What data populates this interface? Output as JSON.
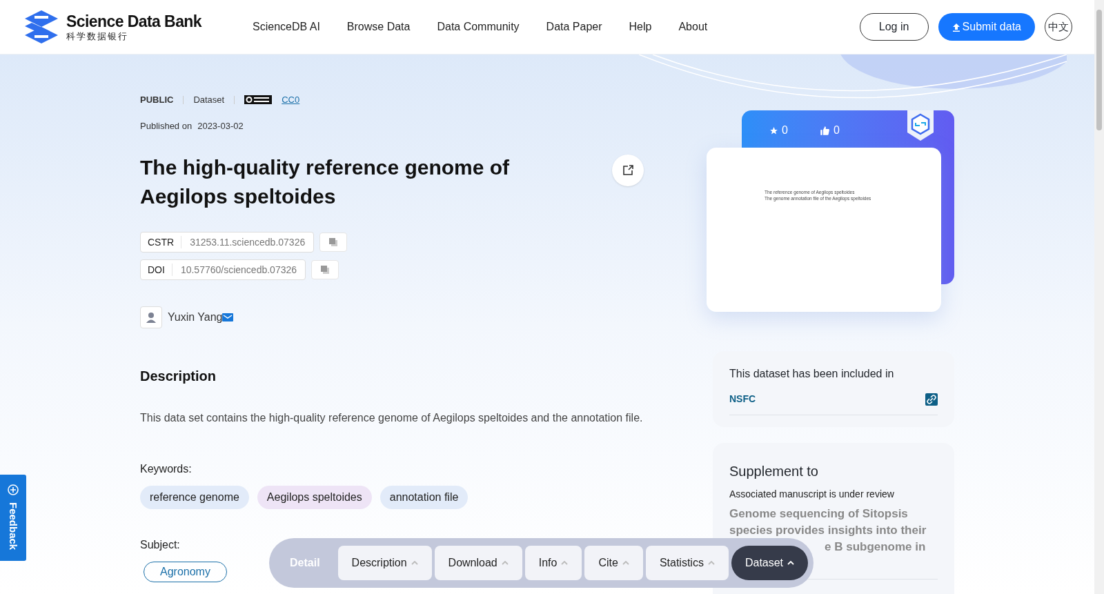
{
  "header": {
    "logo_title": "Science Data Bank",
    "logo_subtitle": "科学数据银行",
    "nav": [
      "ScienceDB AI",
      "Browse Data",
      "Data Community",
      "Data Paper",
      "Help",
      "About"
    ],
    "login": "Log in",
    "submit": "Submit data",
    "language": "中文"
  },
  "dataset": {
    "access": "PUBLIC",
    "type": "Dataset",
    "license": "CC0",
    "published_label": "Published on",
    "published_date": "2023-03-02",
    "title": "The high-quality reference genome of Aegilops speltoides",
    "identifiers": [
      {
        "label": "CSTR",
        "value": "31253.11.sciencedb.07326"
      },
      {
        "label": "DOI",
        "value": "10.57760/sciencedb.07326"
      }
    ],
    "author": "Yuxin Yang",
    "description_heading": "Description",
    "description": "This data set contains the high-quality reference genome of Aegilops speltoides and the annotation file.",
    "keywords_label": "Keywords:",
    "keywords": [
      {
        "text": "reference genome",
        "color": "#e2ebf9"
      },
      {
        "text": "Aegilops speltoides",
        "color": "#eee4f6"
      },
      {
        "text": "annotation file",
        "color": "#e2ebf9"
      }
    ],
    "subject_label": "Subject:",
    "subjects": [
      "Agronomy"
    ]
  },
  "side": {
    "stars": "0",
    "likes": "0",
    "preview_lines": [
      "The reference genome of Aegilops speltoides",
      "The genome annotation file of the Aegilops speltoides"
    ],
    "included_heading": "This dataset has been included in",
    "included": [
      "NSFC"
    ],
    "supplement_heading": "Supplement to",
    "supplement_status": "Associated manuscript is under review",
    "supplement_title": "Genome sequencing of Sitopsis species provides insights into their",
    "supplement_fragment": "e B subgenome in"
  },
  "bottom_nav": {
    "label": "Detail",
    "items": [
      {
        "label": "Description",
        "selected": false
      },
      {
        "label": "Download",
        "selected": false
      },
      {
        "label": "Info",
        "selected": false
      },
      {
        "label": "Cite",
        "selected": false
      },
      {
        "label": "Statistics",
        "selected": false
      },
      {
        "label": "Dataset",
        "selected": true
      }
    ]
  },
  "feedback": "Feedback"
}
